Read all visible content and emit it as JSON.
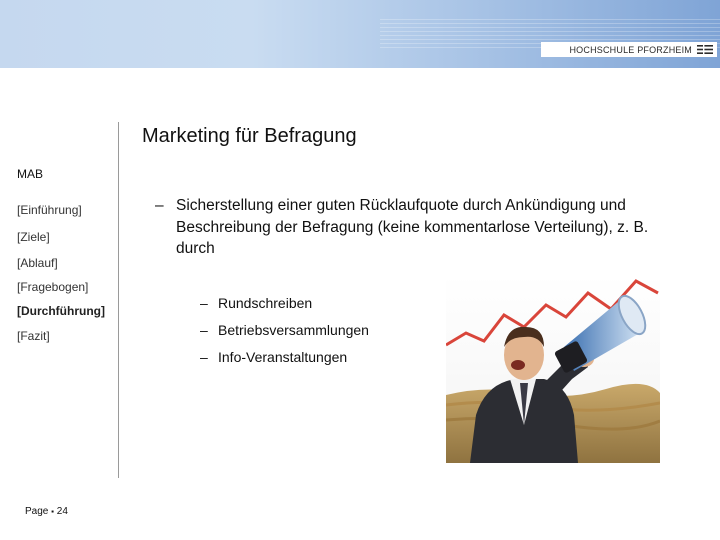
{
  "header": {
    "logo_text": "HOCHSCHULE PFORZHEIM",
    "logo_icon": "hochschule-logo-mark",
    "band_color": "#b9cfec"
  },
  "slide": {
    "title": "Marketing für Befragung",
    "section_label": "MAB",
    "nav": [
      {
        "label": "[Einführung]",
        "active": false
      },
      {
        "label": "[Ziele]",
        "active": false
      },
      {
        "label": "[Ablauf]",
        "active": false
      },
      {
        "label": "[Fragebogen]",
        "active": false
      },
      {
        "label": "[Durchführung]",
        "active": true
      },
      {
        "label": "[Fazit]",
        "active": false
      }
    ],
    "bullet_dash": "–",
    "main_bullet": "Sicherstellung einer guten Rücklaufquote durch Ankündigung und Beschreibung der Befragung (keine kommentarlose Verteilung), z. B. durch",
    "sub_items": [
      "Rundschreiben",
      "Betriebsversammlungen",
      "Info-Veranstaltungen"
    ],
    "photo_icon": "man-with-megaphone-photo"
  },
  "footer": {
    "page_label": "Page ",
    "page_sep": "▪",
    "page_number": "24"
  }
}
